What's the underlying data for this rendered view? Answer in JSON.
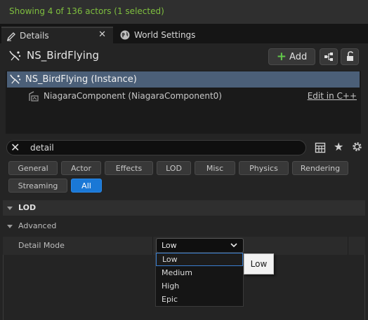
{
  "status": {
    "text": "Showing 4 of 136 actors (1 selected)",
    "color": "#7fbf3f"
  },
  "tabs": [
    {
      "label": "Details",
      "icon": "pencil-icon",
      "active": true,
      "close_icon": "✕"
    },
    {
      "label": "World Settings",
      "icon": "globe-icon",
      "active": false
    }
  ],
  "header": {
    "actor_name": "NS_BirdFlying",
    "actor_icon": "niagara-system-icon",
    "add_label": "Add",
    "add_icon": "+",
    "blueprint_icon": "blueprint-icon",
    "lock_icon": "lock-icon"
  },
  "tree": {
    "instance_label": "NS_BirdFlying (Instance)",
    "component_label": "NiagaraComponent (NiagaraComponent0)",
    "edit_link": "Edit in C++"
  },
  "search": {
    "value": "detail",
    "clear_icon": "✕",
    "star_icon": "★"
  },
  "filters": [
    "General",
    "Actor",
    "Effects",
    "LOD",
    "Misc",
    "Physics",
    "Rendering",
    "Streaming",
    "All"
  ],
  "active_filter": "All",
  "section": {
    "title": "LOD",
    "subsection": "Advanced"
  },
  "property": {
    "label": "Detail Mode",
    "value": "Low"
  },
  "dropdown": {
    "options": [
      "Low",
      "Medium",
      "High",
      "Epic"
    ],
    "selected": "Low"
  },
  "tooltip": {
    "text": "Low"
  },
  "colors": {
    "accent": "#1a78d6",
    "selection": "#4b5f78",
    "add_plus": "#62c84a"
  }
}
